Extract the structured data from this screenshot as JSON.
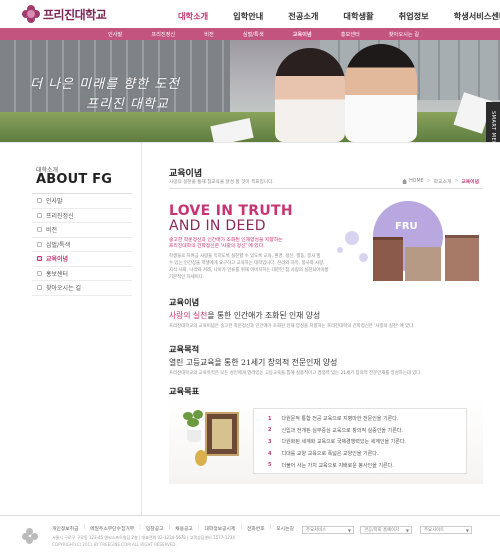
{
  "header": {
    "logo_text": "프리진대학교",
    "gnb": [
      "대학소개",
      "입학안내",
      "전공소개",
      "대학생활",
      "취업정보",
      "학생서비스센터"
    ],
    "gnb_active": "대학소개"
  },
  "subnav": {
    "items": [
      "인사말",
      "프리진정신",
      "비전",
      "심벌/특색",
      "교육이념",
      "홍보센터",
      "찾아오시는 길"
    ],
    "active": "교육이념"
  },
  "hero": {
    "line1": "더 나은 미래를 향한 도전",
    "line2": "프리진 대학교"
  },
  "smart_menu": "SMART MENU",
  "sidebar": {
    "sub": "대학소개",
    "title": "ABOUT FG",
    "items": [
      "인사말",
      "프리진정신",
      "비전",
      "심벌/특색",
      "교육이념",
      "홍보센터",
      "찾아오시는 길"
    ],
    "active_index": 4
  },
  "main": {
    "title": "교육이념",
    "desc": "사랑의 실천을 통해 참교육을 달성 할 것이 목표입니다.",
    "breadcrumb": [
      "HOME",
      "학교소개",
      "교육이념"
    ],
    "love": "LOVE IN TRUTH",
    "indeed": "AND IN DEED",
    "intro_line1": "숭고한 학문정신과 인간애가 조화된 인재양성을 지향하는",
    "intro_line2": "프리진대학의 건학정신은 '사랑의 정신' 에 있다.",
    "body": [
      "학생들로 하여금 사랑을 익히도록 실천할 수 있도록 교육, 환경, 정신, 행동, 봉사 할",
      "수 있는 인간상을 학생에게 요구하고 교육하는 대학입니다. 진리와 자유, 봉사와 사랑,",
      "지식 사회, 나라와 겨레, 나아가 인류를 위해 이바지하는 대한민 참 사람의 실천되어야할",
      "기본적인 자세이다."
    ],
    "fru_label": "FRU",
    "sections": [
      {
        "heading": "교육이념",
        "slogan_hl": "사랑의 실천",
        "slogan_rest": "을 통한 인간애가 조화된 인재 양성",
        "desc": "프리진대학교의 교육이념은 숭고한 학문정신과 인간애가 조화된 인재 양성을 지향하는 프리진대학의 건학정신은 '사랑의 실천' 에 있다."
      },
      {
        "heading": "교육목적",
        "slogan_hl": "",
        "slogan_rest": "열린 고등교육을 통한 21세기 창의적 전문인재 양성",
        "desc": "프리진대학교의 교육목적은 모든 성인에게 열려있는 고등교육을 통해 실용적이고 경쟁력 있는 21세기 창의적 전문인재를 양성하는데 있다."
      }
    ],
    "goal_heading": "교육목표",
    "goals": [
      "다원문적 통합 전공 교육으로 지병마한 전문인을 기른다.",
      "신입과 전개된 실무중심 교육으로 창의적 실증인을 기른다.",
      "다원화된 세계화 교육으로 국제경쟁력있는 세계인을 기른다.",
      "디대를 교양 교육으로 폭넓은 교양인을 기른다.",
      "더불어 사는 가치 교육으로 지배로운 봉사인을 기른다."
    ]
  },
  "footer": {
    "links": [
      "개인정보취급",
      "메일주소무단수집거부",
      "입찰공고",
      "채용공고",
      "대학정보공시제",
      "전화번호",
      "오시는길"
    ],
    "address": "서울시 구로구 구로동 123-45 엔씨소프트빌딩 2층 | 대표전화 02-1234-5678 | 고객상담센터 1577-1234",
    "copyright": "COPYRIGHT(C) 2011 BY FREEGINE.COM ALL RIGHT RESERVED.",
    "selects": [
      "주요서비스",
      "관공/학회 홈페이지",
      "주요사이트"
    ]
  },
  "colors": {
    "accent": "#c73473",
    "subnav_bg": "#c3547f",
    "logo": "#7d2656",
    "fru_circle": "#b9a8e0"
  }
}
